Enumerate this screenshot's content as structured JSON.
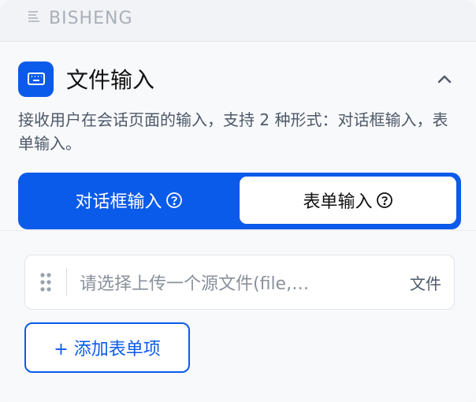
{
  "brand": {
    "name": "BISHENG"
  },
  "node": {
    "title": "文件输入",
    "description": "接收用户在会话页面的输入，支持 2 种形式：对话框输入，表单输入。"
  },
  "mode_switch": {
    "tabs": [
      {
        "label": "对话框输入",
        "selected": true
      },
      {
        "label": "表单输入",
        "selected": false
      }
    ]
  },
  "form_items": [
    {
      "placeholder": "请选择上传一个源文件(file,…",
      "type": "文件"
    }
  ],
  "add_button": {
    "label": "+ 添加表单项"
  },
  "colors": {
    "accent": "#0b5bea",
    "text": "#1f2329",
    "muted": "#4e5969"
  }
}
